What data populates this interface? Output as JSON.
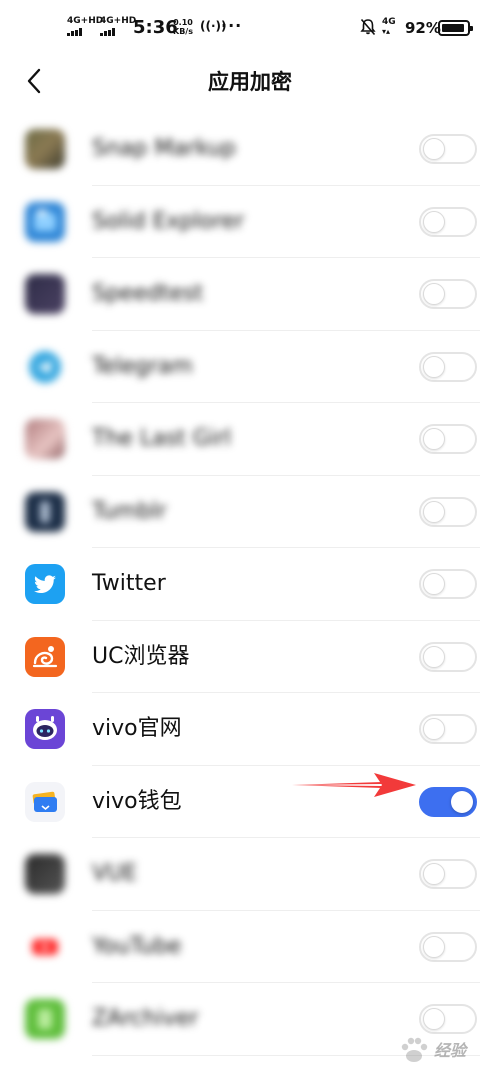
{
  "status_bar": {
    "sim1": "4G+HD",
    "sim2": "4G+HD",
    "time": "5:36",
    "speed_value": "0.10",
    "speed_unit": "KB/s",
    "network_right": "4G",
    "battery_percent": "92%",
    "battery_level": 0.92
  },
  "header": {
    "title": "应用加密",
    "back_icon": "chevron-left-icon"
  },
  "apps": [
    {
      "name": "Snap Markup",
      "enabled": false,
      "blurred": true,
      "icon": "snap-markup-icon"
    },
    {
      "name": "Solid Explorer",
      "enabled": false,
      "blurred": true,
      "icon": "solid-explorer-icon"
    },
    {
      "name": "Speedtest",
      "enabled": false,
      "blurred": true,
      "icon": "speedtest-icon"
    },
    {
      "name": "Telegram",
      "enabled": false,
      "blurred": true,
      "icon": "telegram-icon"
    },
    {
      "name": "The Last Girl",
      "enabled": false,
      "blurred": true,
      "icon": "the-last-girl-icon"
    },
    {
      "name": "Tumblr",
      "enabled": false,
      "blurred": true,
      "icon": "tumblr-icon"
    },
    {
      "name": "Twitter",
      "enabled": false,
      "blurred": false,
      "icon": "twitter-icon"
    },
    {
      "name": "UC浏览器",
      "enabled": false,
      "blurred": false,
      "icon": "uc-browser-icon"
    },
    {
      "name": "vivo官网",
      "enabled": false,
      "blurred": false,
      "icon": "vivo-official-icon"
    },
    {
      "name": "vivo钱包",
      "enabled": true,
      "blurred": false,
      "icon": "vivo-wallet-icon"
    },
    {
      "name": "VUE",
      "enabled": false,
      "blurred": true,
      "icon": "vue-icon"
    },
    {
      "name": "YouTube",
      "enabled": false,
      "blurred": true,
      "icon": "youtube-icon"
    },
    {
      "name": "ZArchiver",
      "enabled": false,
      "blurred": true,
      "icon": "zarchiver-icon"
    }
  ],
  "colors": {
    "toggle_on": "#3d6ff0",
    "arrow": "#f23a3a"
  },
  "watermark": {
    "text": "经验"
  }
}
